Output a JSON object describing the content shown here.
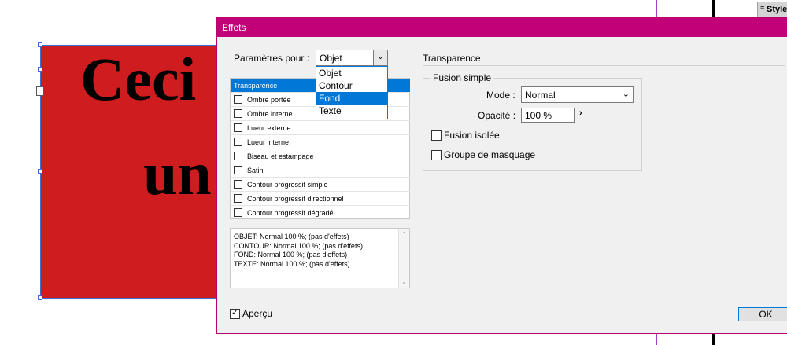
{
  "canvas": {
    "frame_text_line1": "Ceci",
    "frame_text_line2": "un",
    "frame_color": "#cf1c1f"
  },
  "styles_tab": {
    "label": "Style"
  },
  "dialog": {
    "title": "Effets",
    "settings_label": "Paramètres pour :",
    "settings_value": "Objet",
    "dropdown_options": [
      {
        "label": "Objet"
      },
      {
        "label": "Contour"
      },
      {
        "label": "Fond"
      },
      {
        "label": "Texte"
      }
    ],
    "effects_list": [
      {
        "label": "Transparence"
      },
      {
        "label": "Ombre portée"
      },
      {
        "label": "Ombre interne"
      },
      {
        "label": "Lueur externe"
      },
      {
        "label": "Lueur interne"
      },
      {
        "label": "Biseau et estampage"
      },
      {
        "label": "Satin"
      },
      {
        "label": "Contour progressif simple"
      },
      {
        "label": "Contour progressif directionnel"
      },
      {
        "label": "Contour progressif dégradé"
      }
    ],
    "summary_lines": [
      "OBJET: Normal 100 %; (pas d'effets)",
      "CONTOUR: Normal 100 %; (pas d'effets)",
      "FOND: Normal 100 %; (pas d'effets)",
      "TEXTE: Normal 100 %; (pas d'effets)"
    ],
    "section_title": "Transparence",
    "group_title": "Fusion simple",
    "mode_label": "Mode :",
    "mode_value": "Normal",
    "opacity_label": "Opacité :",
    "opacity_value": "100 %",
    "isolate_label": "Fusion isolée",
    "knockout_label": "Groupe de masquage",
    "preview_label": "Aperçu",
    "ok_label": "OK"
  },
  "colors": {
    "titlebar": "#c20078",
    "selection": "#0078d7"
  }
}
